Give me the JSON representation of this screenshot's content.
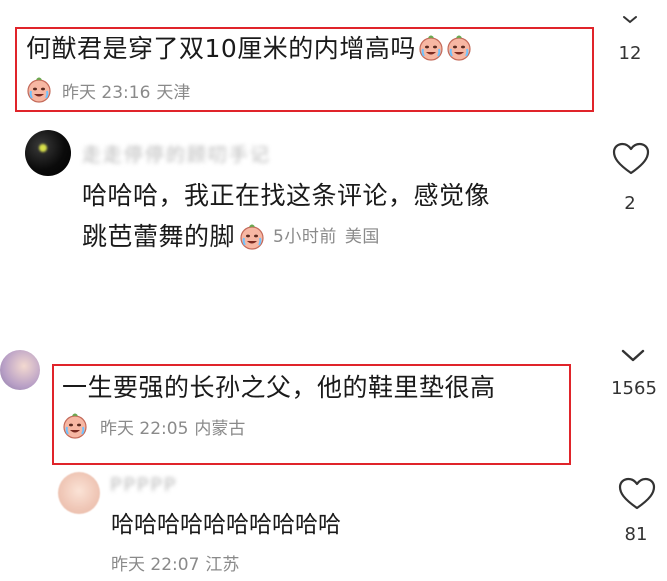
{
  "comments": [
    {
      "text": "何猷君是穿了双10厘米的内增高吗",
      "time": "昨天 23:16",
      "location": "天津",
      "like_count": "12"
    },
    {
      "username": "走走停停的顾叨手记",
      "text_line1": "哈哈哈，我正在找这条评论，感觉像",
      "text_line2": "跳芭蕾舞的脚",
      "time": "5小时前",
      "location": "美国",
      "like_count": "2"
    },
    {
      "text": "一生要强的长孙之父，他的鞋里垫很高",
      "time": "昨天 22:05",
      "location": "内蒙古",
      "like_count": "1565"
    },
    {
      "username": "PPPPP",
      "text": "哈哈哈哈哈哈哈哈哈哈",
      "time": "昨天 22:07",
      "location": "江苏",
      "like_count": "81"
    }
  ],
  "colors": {
    "highlight": "#e0242a",
    "meta_text": "#8a8a8a",
    "heart_outline": "#333333"
  },
  "icons": [
    "crying-laugh-emoji",
    "heart-icon",
    "chevron-down-icon"
  ]
}
